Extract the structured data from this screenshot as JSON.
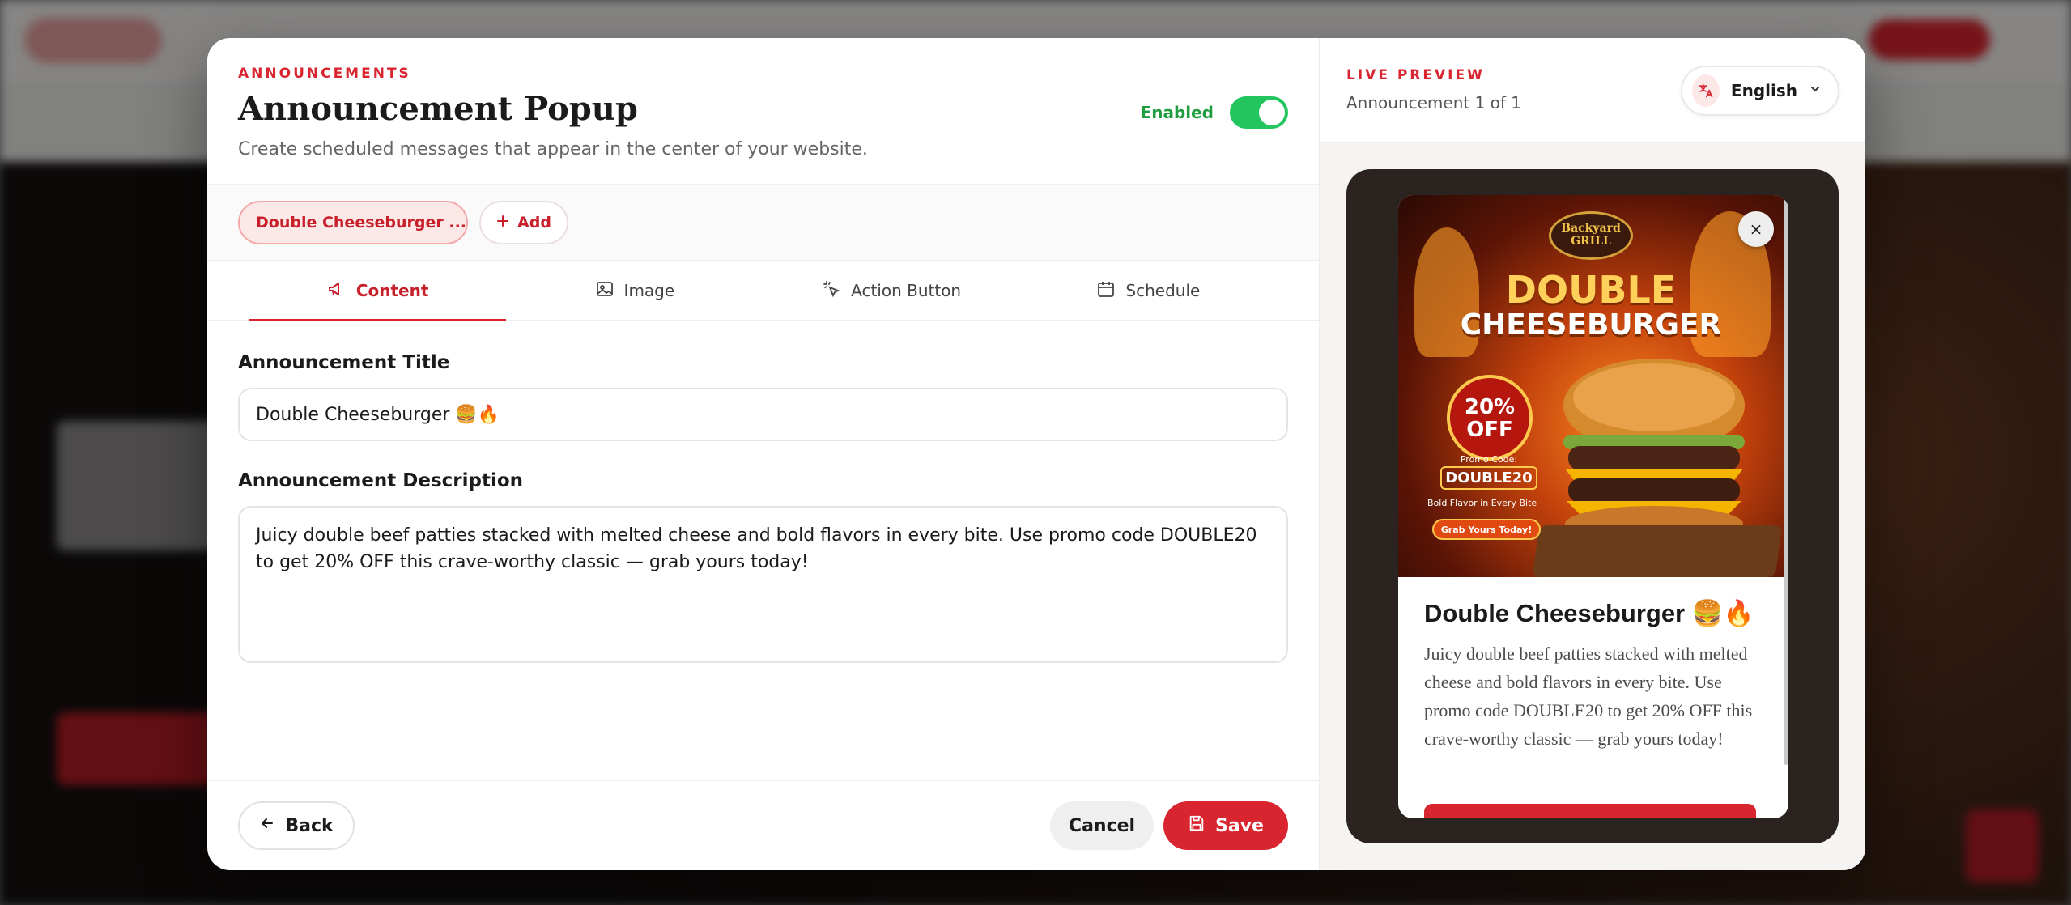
{
  "header": {
    "eyebrow": "ANNOUNCEMENTS",
    "title": "Announcement Popup",
    "subtitle": "Create scheduled messages that appear in the center of your website.",
    "enabled_label": "Enabled",
    "enabled": true
  },
  "chips": {
    "active_label": "Double Cheeseburger ...",
    "add_label": "Add"
  },
  "tabs": [
    {
      "label": "Content",
      "icon": "megaphone-icon",
      "active": true
    },
    {
      "label": "Image",
      "icon": "image-icon",
      "active": false
    },
    {
      "label": "Action Button",
      "icon": "pointer-icon",
      "active": false
    },
    {
      "label": "Schedule",
      "icon": "calendar-icon",
      "active": false
    }
  ],
  "form": {
    "title_label": "Announcement Title",
    "title_value": "Double Cheeseburger 🍔🔥",
    "description_label": "Announcement Description",
    "description_value": "Juicy double beef patties stacked with melted cheese and bold flavors in every bite. Use promo code DOUBLE20 to get 20% OFF this crave-worthy classic — grab yours today!"
  },
  "footer": {
    "back_label": "Back",
    "cancel_label": "Cancel",
    "save_label": "Save"
  },
  "preview": {
    "eyebrow": "LIVE PREVIEW",
    "count": "Announcement 1 of 1",
    "language": "English",
    "close_symbol": "×",
    "popup_title": "Double Cheeseburger 🍔🔥",
    "popup_description": "Juicy double beef patties stacked with melted cheese and bold flavors in every bite. Use promo code DOUBLE20 to get 20% OFF this crave-worthy classic — grab yours today!",
    "image_text": {
      "brand": "Backyard GRILL",
      "headline_1": "DOUBLE",
      "headline_2": "CHEESEBURGER",
      "badge": "20% OFF",
      "promo_label": "Promo Code:",
      "promo_code": "DOUBLE20",
      "tagline": "Bold Flavor in Every Bite",
      "cta": "Grab Yours Today!"
    }
  },
  "colors": {
    "accent": "#d9252f",
    "toggle_on": "#22c55e",
    "enabled_text": "#1f9d3f"
  }
}
